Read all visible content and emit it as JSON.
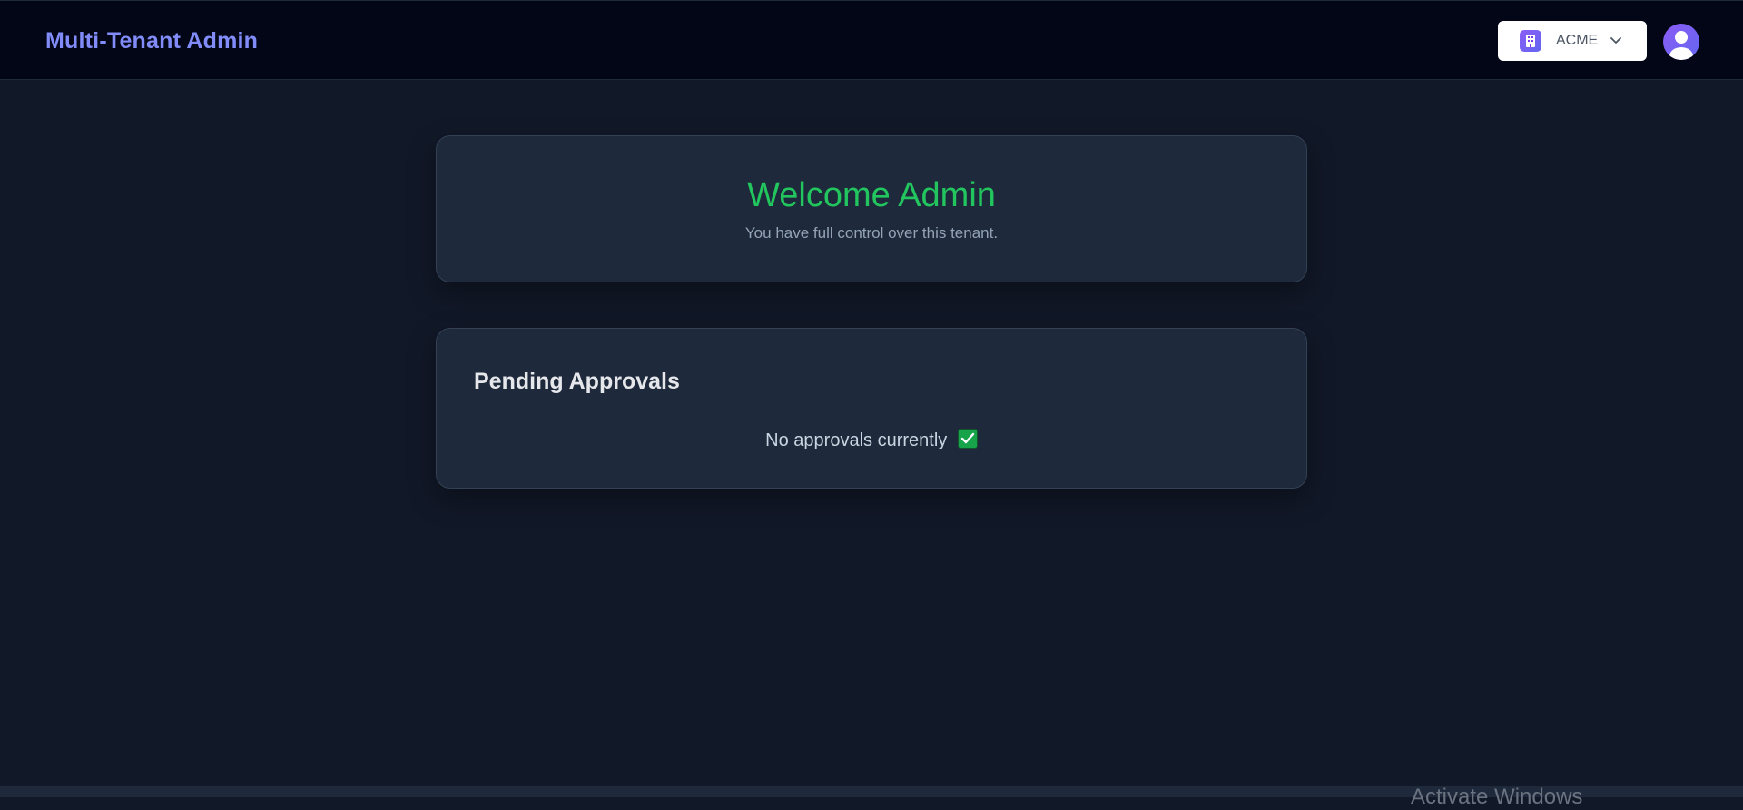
{
  "header": {
    "brand": "Multi-Tenant Admin",
    "tenant_selector": {
      "value": "ACME",
      "icon": "building-icon"
    },
    "avatar_icon": "user-avatar-icon"
  },
  "welcome": {
    "title": "Welcome Admin",
    "subtitle": "You have full control over this tenant."
  },
  "approvals": {
    "title": "Pending Approvals",
    "empty_message": "No approvals currently",
    "empty_icon": "check-mark-icon"
  },
  "os_overlay": {
    "watermark": "Activate Windows"
  },
  "colors": {
    "background": "#111827",
    "navbar": "#020617",
    "brand": "#818cf8",
    "welcome_title": "#22c55e",
    "card": "#1e293b"
  }
}
